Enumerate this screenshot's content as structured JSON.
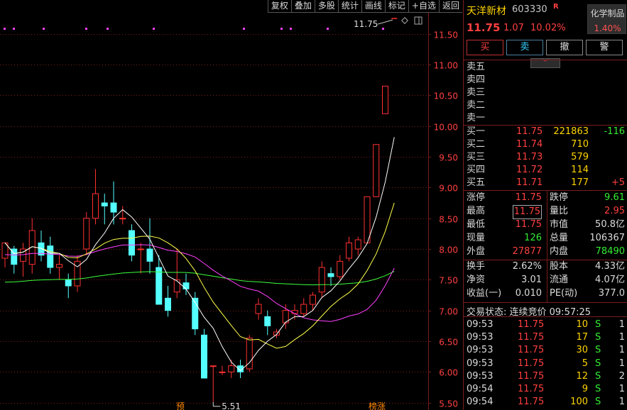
{
  "toolbar": [
    "复权",
    "叠加",
    "多股",
    "统计",
    "画线",
    "标记",
    "+自选",
    "返回"
  ],
  "chart": {
    "high_label": "11.75",
    "low_label": "5.51",
    "flag_left": "预",
    "flag_right": "榜涨",
    "dotted_marks": "· · · · · · · · ·",
    "colors": {
      "up": "#ff3030",
      "down": "#54ffff",
      "ma5": "#ffffff",
      "ma10": "#ffff4a",
      "ma20": "#ff40ff",
      "ma60": "#3cff3c",
      "grid": "#7a1c1c"
    }
  },
  "chart_data": {
    "type": "candlestick",
    "y_ticks": [
      "11.50",
      "11.00",
      "10.50",
      "10.00",
      "9.50",
      "9.00",
      "8.50",
      "8.00",
      "7.50",
      "7.00",
      "6.50",
      "6.00",
      "5.50"
    ],
    "ylim": [
      5.45,
      11.82
    ],
    "candles": [
      [
        7.85,
        8.1,
        7.7,
        8.0
      ],
      [
        8.0,
        7.75,
        7.6,
        8.05
      ],
      [
        7.8,
        8.0,
        7.55,
        8.1
      ],
      [
        7.75,
        8.3,
        7.6,
        8.5
      ],
      [
        8.1,
        7.9,
        7.8,
        8.3
      ],
      [
        8.05,
        7.7,
        7.6,
        8.2
      ],
      [
        7.7,
        7.75,
        7.5,
        7.9
      ],
      [
        7.5,
        7.4,
        7.2,
        7.6
      ],
      [
        7.4,
        7.8,
        7.3,
        7.9
      ],
      [
        8.0,
        8.5,
        7.9,
        8.6
      ],
      [
        8.5,
        8.9,
        8.4,
        9.3
      ],
      [
        8.75,
        8.7,
        8.4,
        8.9
      ],
      [
        8.75,
        8.6,
        8.4,
        9.1
      ],
      [
        8.5,
        8.5,
        8.4,
        8.7
      ],
      [
        8.3,
        7.9,
        7.8,
        8.4
      ],
      [
        8.0,
        8.0,
        7.6,
        8.1
      ],
      [
        8.0,
        7.8,
        7.6,
        8.5
      ],
      [
        7.7,
        7.1,
        7.1,
        7.9
      ],
      [
        7.2,
        7.0,
        6.9,
        7.4
      ],
      [
        7.3,
        7.5,
        7.2,
        8.0
      ],
      [
        7.45,
        7.35,
        7.25,
        7.6
      ],
      [
        7.2,
        6.7,
        6.6,
        7.3
      ],
      [
        6.6,
        5.9,
        5.9,
        6.7
      ],
      [
        6.1,
        6.1,
        5.51,
        6.1
      ],
      [
        6.0,
        6.0,
        5.95,
        6.1
      ],
      [
        6.0,
        6.1,
        5.9,
        6.2
      ],
      [
        6.1,
        6.0,
        5.9,
        6.2
      ],
      [
        6.05,
        6.55,
        6.0,
        6.6
      ],
      [
        6.95,
        7.1,
        6.85,
        7.2
      ],
      [
        6.9,
        6.75,
        6.6,
        7.0
      ],
      [
        6.6,
        6.65,
        6.55,
        6.7
      ],
      [
        6.8,
        7.0,
        6.7,
        7.1
      ],
      [
        6.95,
        7.0,
        6.85,
        7.1
      ],
      [
        6.95,
        7.1,
        6.9,
        7.2
      ],
      [
        7.1,
        7.25,
        7.0,
        7.3
      ],
      [
        7.3,
        7.7,
        7.2,
        7.8
      ],
      [
        7.6,
        7.55,
        7.4,
        7.7
      ],
      [
        7.55,
        7.8,
        7.5,
        7.9
      ],
      [
        7.85,
        8.1,
        7.8,
        8.2
      ],
      [
        8.0,
        8.15,
        7.9,
        8.2
      ],
      [
        8.1,
        8.85,
        8.1,
        8.85
      ],
      [
        8.85,
        9.7,
        8.85,
        9.7
      ],
      [
        10.2,
        10.65,
        10.2,
        10.65
      ]
    ]
  },
  "header": {
    "name": "天洋新材",
    "code": "603330",
    "flag": "R",
    "price": "11.75",
    "change": "1.07",
    "change_pct": "10.02%",
    "sector": "化学制品",
    "sector_pct": "1.40%"
  },
  "buttons": {
    "buy": "买",
    "sell": "卖",
    "cancel": "撤",
    "alert": "警"
  },
  "collapse_icon": "﹀",
  "asks": [
    {
      "label": "卖五"
    },
    {
      "label": "卖四"
    },
    {
      "label": "卖三"
    },
    {
      "label": "卖二"
    },
    {
      "label": "卖一"
    }
  ],
  "bids": [
    {
      "label": "买一",
      "price": "11.75",
      "vol": "221863",
      "chg": "-116"
    },
    {
      "label": "买二",
      "price": "11.74",
      "vol": "710",
      "chg": ""
    },
    {
      "label": "买三",
      "price": "11.73",
      "vol": "579",
      "chg": ""
    },
    {
      "label": "买四",
      "price": "11.72",
      "vol": "114",
      "chg": ""
    },
    {
      "label": "买五",
      "price": "11.71",
      "vol": "177",
      "chg": "+5"
    }
  ],
  "stats1": [
    {
      "l1": "涨停",
      "v1": "11.75",
      "l2": "跌停",
      "v2": "9.61"
    },
    {
      "l1": "最高",
      "v1": "11.75",
      "l2": "量比",
      "v2": "2.95"
    },
    {
      "l1": "最低",
      "v1": "11.75",
      "l2": "市值",
      "v2": "50.8亿"
    },
    {
      "l1": "现量",
      "v1": "126",
      "l2": "总量",
      "v2": "106367"
    },
    {
      "l1": "外盘",
      "v1": "27877",
      "l2": "内盘",
      "v2": "78490"
    }
  ],
  "stats2": [
    {
      "l1": "换手",
      "v1": "2.62%",
      "l2": "股本",
      "v2": "4.33亿"
    },
    {
      "l1": "净资",
      "v1": "3.01",
      "l2": "流通",
      "v2": "4.07亿"
    },
    {
      "l1": "收益(一)",
      "v1": "0.010",
      "l2": "PE(动)",
      "v2": "377.0"
    }
  ],
  "status": "交易状态: 连续竞价 09:57:25",
  "ticks": [
    {
      "time": "09:53",
      "price": "11.75",
      "vol": "10",
      "side": "S",
      "n": "1"
    },
    {
      "time": "09:53",
      "price": "11.75",
      "vol": "17",
      "side": "S",
      "n": "1"
    },
    {
      "time": "09:53",
      "price": "11.75",
      "vol": "30",
      "side": "S",
      "n": "1"
    },
    {
      "time": "09:53",
      "price": "11.75",
      "vol": "5",
      "side": "S",
      "n": "1"
    },
    {
      "time": "09:53",
      "price": "11.75",
      "vol": "12",
      "side": "S",
      "n": "2"
    },
    {
      "time": "09:54",
      "price": "11.75",
      "vol": "9",
      "side": "S",
      "n": "1"
    },
    {
      "time": "09:54",
      "price": "11.75",
      "vol": "100",
      "side": "S",
      "n": "1"
    }
  ]
}
